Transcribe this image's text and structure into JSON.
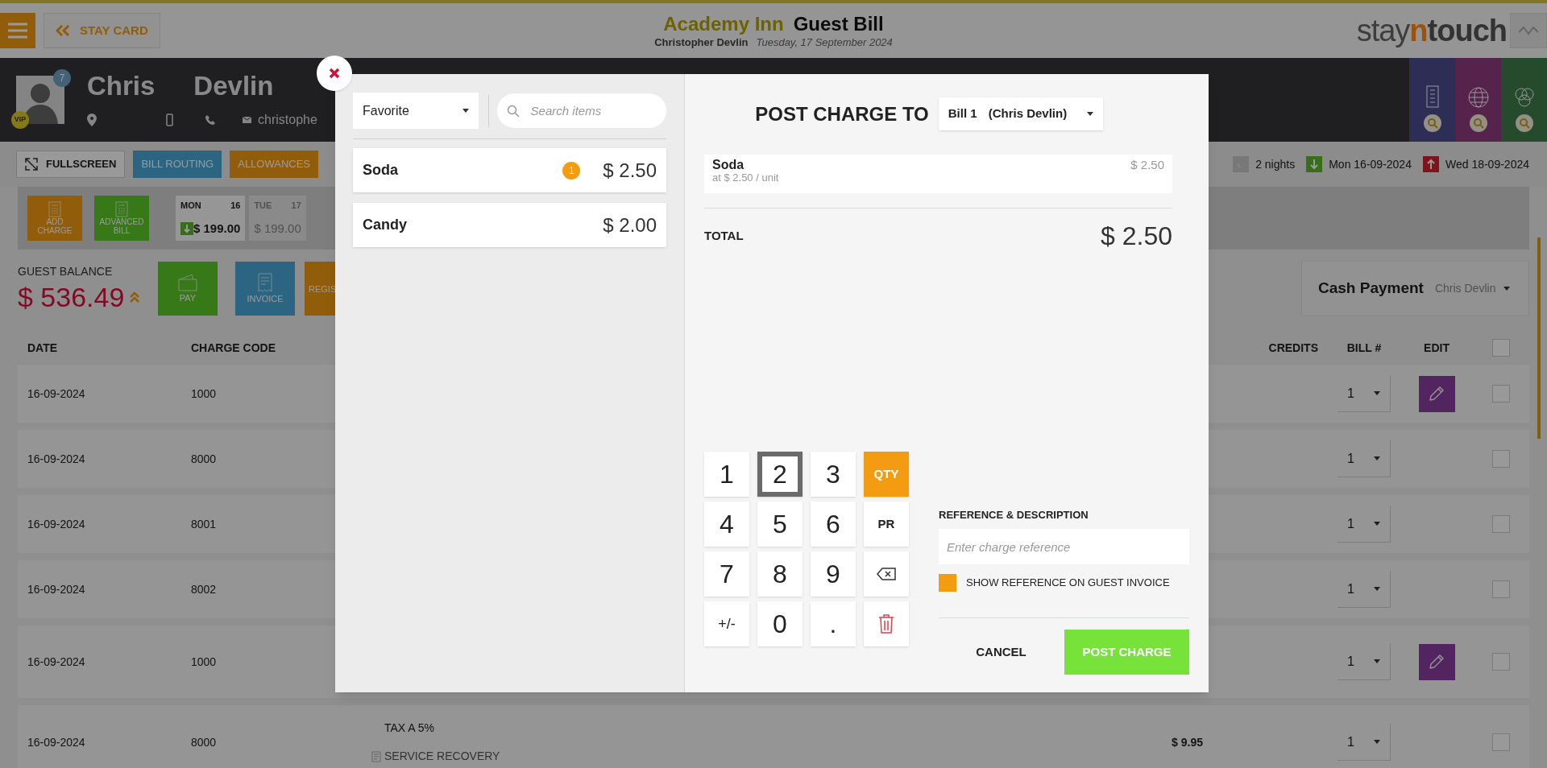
{
  "header": {
    "back_button": "STAY CARD",
    "hotel": "Academy Inn",
    "title": "Guest Bill",
    "guest": "Christopher Devlin",
    "date": "Tuesday, 17 September 2024",
    "logo": [
      "stay",
      "n",
      "touch"
    ]
  },
  "guest": {
    "first_name": "Chris",
    "last_name": "Devlin",
    "badge": "7",
    "vip": "VIP",
    "email": "christophe"
  },
  "toolbar": [
    {
      "label": "FULLSCREEN",
      "kind": "fullscreen"
    },
    {
      "label": "BILL ROUTING",
      "kind": "blue"
    },
    {
      "label": "ALLOWANCES",
      "kind": "orange"
    }
  ],
  "stay": {
    "nights": "2 nights",
    "arrival": "Mon 16-09-2024",
    "departure": "Wed 18-09-2024"
  },
  "actions": [
    {
      "label": "ADD CHARGE",
      "kind": "orange"
    },
    {
      "label": "ADVANCED BILL",
      "kind": "green"
    }
  ],
  "days": [
    {
      "day": "MON",
      "date": "16",
      "amount": "$ 199.00",
      "selected": true,
      "arrival": true
    },
    {
      "day": "TUE",
      "date": "17",
      "amount": "$ 199.00",
      "selected": false,
      "arrival": false
    }
  ],
  "balance": {
    "label": "GUEST BALANCE",
    "amount": "$ 536.49"
  },
  "bill_buttons": [
    {
      "lines": [
        "PAY"
      ],
      "kind": "green"
    },
    {
      "lines": [
        "INVOICE"
      ],
      "kind": "blue"
    },
    {
      "lines": [
        "REGIS"
      ],
      "kind": "orange"
    }
  ],
  "payment": {
    "method": "Cash Payment",
    "payer": "Chris Devlin"
  },
  "table": {
    "columns": [
      "DATE",
      "CHARGE CODE",
      "CREDITS",
      "BILL #",
      "EDIT"
    ],
    "header_checked": false,
    "rows": [
      {
        "date": "16-09-2024",
        "code": "1000",
        "bill": "1",
        "editable": true,
        "checked": false
      },
      {
        "date": "16-09-2024",
        "code": "8000",
        "bill": "1",
        "editable": false,
        "checked": false
      },
      {
        "date": "16-09-2024",
        "code": "8001",
        "bill": "1",
        "editable": false,
        "checked": false
      },
      {
        "date": "16-09-2024",
        "code": "8002",
        "bill": "1",
        "editable": false,
        "checked": false
      },
      {
        "date": "16-09-2024",
        "code": "1000",
        "bill": "1",
        "editable": true,
        "checked": false
      },
      {
        "date": "16-09-2024",
        "code": "8000",
        "description": [
          "TAX A 5%",
          "SERVICE RECOVERY"
        ],
        "amount": "$ 9.95",
        "bill": "1",
        "editable": false,
        "checked": false
      }
    ]
  },
  "modal": {
    "category": "Favorite",
    "search_placeholder": "Search items",
    "items": [
      {
        "name": "Soda",
        "count": "1",
        "price": "$ 2.50"
      },
      {
        "name": "Candy",
        "price": "$ 2.00"
      }
    ],
    "post_to_label": "POST CHARGE TO",
    "bill": "Bill 1",
    "bill_owner": "(Chris Devlin)",
    "lines": [
      {
        "name": "Soda",
        "unit": "at $ 2.50 / unit",
        "amount": "$ 2.50"
      }
    ],
    "total_label": "TOTAL",
    "total": "$ 2.50",
    "keypad": [
      {
        "label": "1",
        "kind": "digit",
        "selected": false
      },
      {
        "label": "2",
        "kind": "digit",
        "selected": true
      },
      {
        "label": "3",
        "kind": "digit",
        "selected": false
      },
      {
        "label": "QTY",
        "kind": "qty",
        "selected": false
      },
      {
        "label": "4",
        "kind": "digit",
        "selected": false
      },
      {
        "label": "5",
        "kind": "digit",
        "selected": false
      },
      {
        "label": "6",
        "kind": "digit",
        "selected": false
      },
      {
        "label": "PR",
        "kind": "pr",
        "selected": false
      },
      {
        "label": "7",
        "kind": "digit",
        "selected": false
      },
      {
        "label": "8",
        "kind": "digit",
        "selected": false
      },
      {
        "label": "9",
        "kind": "digit",
        "selected": false
      },
      {
        "kind": "backspace",
        "selected": false
      },
      {
        "label": "+/-",
        "kind": "sign",
        "selected": false
      },
      {
        "label": "0",
        "kind": "digit",
        "selected": false
      },
      {
        "label": ".",
        "kind": "digit",
        "selected": false
      },
      {
        "kind": "clear",
        "selected": false
      }
    ],
    "reference_label": "REFERENCE & DESCRIPTION",
    "reference_placeholder": "Enter charge reference",
    "show_on_invoice": {
      "label": "SHOW REFERENCE ON GUEST INVOICE",
      "checked": true
    },
    "cancel": "CANCEL",
    "submit": "POST CHARGE"
  }
}
